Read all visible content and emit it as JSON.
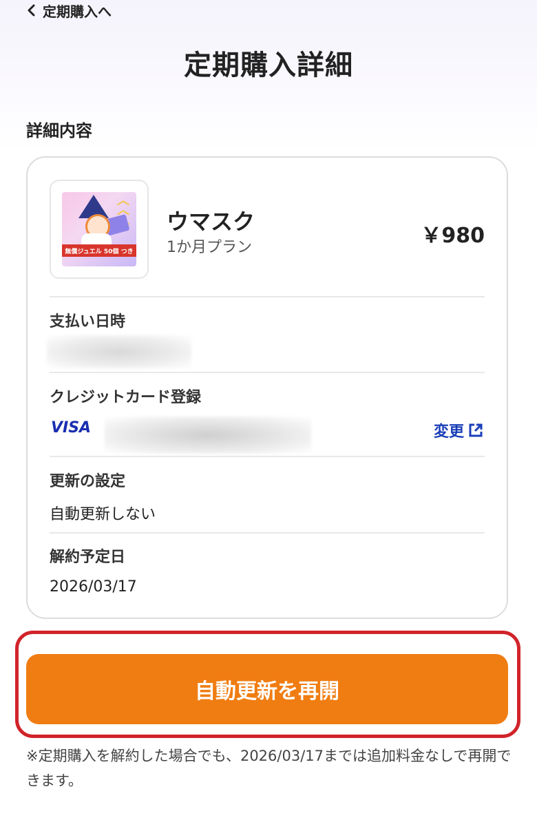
{
  "nav": {
    "back_label": "定期購入へ"
  },
  "page": {
    "title": "定期購入詳細"
  },
  "section": {
    "title": "詳細内容"
  },
  "product": {
    "name": "ウマスク",
    "plan": "1か月プラン",
    "price": "￥980",
    "thumbnail_banner": "無償ジュエル 50個 つき",
    "thumbnail_icon": "product-thumbnail-image"
  },
  "fields": {
    "payment_datetime_label": "支払い日時",
    "credit_card_label": "クレジットカード登録",
    "card_brand": "VISA",
    "change_label": "変更",
    "renewal_label": "更新の設定",
    "renewal_value": "自動更新しない",
    "cancel_date_label": "解約予定日",
    "cancel_date_value": "2026/03/17"
  },
  "cta": {
    "label": "自動更新を再開"
  },
  "note": {
    "text": "※定期購入を解約した場合でも、2026/03/17までは追加料金なしで再開できます。"
  },
  "colors": {
    "accent": "#f07d12",
    "highlight_border": "#d0242a",
    "link": "#1a3fb8",
    "visa": "#1a2fb0"
  }
}
